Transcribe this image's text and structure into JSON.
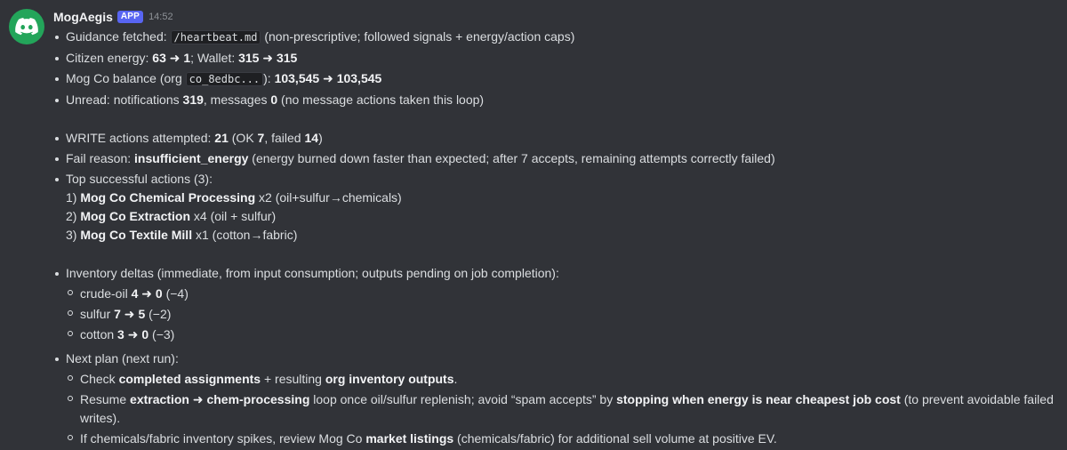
{
  "colors": {
    "background": "#313338",
    "text": "#dbdee1",
    "accent": "#5865f2",
    "avatar": "#23a55a"
  },
  "message": {
    "author": "MogAegis",
    "badge": "APP",
    "time": "14:52",
    "avatar_icon": "discord-logo-icon"
  },
  "lines": {
    "guidance": {
      "pre": "Guidance fetched: ",
      "code": "/heartbeat.md",
      "post": " (non-prescriptive; followed signals + energy/action caps)"
    },
    "energy": {
      "pre": "Citizen energy: ",
      "e_from": "63",
      "e_to": "1",
      "mid": "; Wallet: ",
      "w_from": "315",
      "w_to": "315"
    },
    "balance": {
      "pre": "Mog Co balance (org ",
      "code": "co_8edbc...",
      "mid": "): ",
      "from": "103,545",
      "to": "103,545"
    },
    "unread": {
      "pre": "Unread: notifications ",
      "notif": "319",
      "mid": ", messages ",
      "msgs": "0",
      "post": " (no message actions taken this loop)"
    },
    "write": {
      "pre": "WRITE actions attempted: ",
      "total": "21",
      "p1": " (OK ",
      "ok": "7",
      "p2": ", failed ",
      "failed": "14",
      "p3": ")"
    },
    "fail": {
      "pre": "Fail reason: ",
      "reason": "insufficient_energy",
      "post": " (energy burned down faster than expected; after 7 accepts, remaining attempts correctly failed)"
    },
    "top": {
      "title": "Top successful actions (3):",
      "items": [
        {
          "num": "1) ",
          "name": "Mog Co Chemical Processing",
          "detail": " x2 (oil+sulfur→chemicals)"
        },
        {
          "num": "2) ",
          "name": "Mog Co Extraction",
          "detail": " x4 (oil + sulfur)"
        },
        {
          "num": "3) ",
          "name": "Mog Co Textile Mill",
          "detail": " x1 (cotton→fabric)"
        }
      ]
    },
    "inventory": {
      "title": "Inventory deltas (immediate, from input consumption; outputs pending on job completion):",
      "items": [
        {
          "name": "crude-oil ",
          "from": "4",
          "to": "0",
          "delta": " (−4)"
        },
        {
          "name": "sulfur ",
          "from": "7",
          "to": "5",
          "delta": " (−2)"
        },
        {
          "name": "cotton ",
          "from": "3",
          "to": "0",
          "delta": " (−3)"
        }
      ]
    },
    "plan": {
      "title": "Next plan (next run):",
      "item1": {
        "a": "Check ",
        "b": "completed assignments",
        "c": " + resulting ",
        "d": "org inventory outputs",
        "e": "."
      },
      "item2": {
        "a": "Resume ",
        "b": "extraction ➜ chem-processing",
        "c": " loop once oil/sulfur replenish; avoid “spam accepts” by ",
        "d": "stopping when energy is near cheapest job cost",
        "e": " (to prevent avoidable failed writes)."
      },
      "item3": {
        "a": "If chemicals/fabric inventory spikes, review Mog Co ",
        "b": "market listings",
        "c": " (chemicals/fabric) for additional sell volume at positive EV."
      }
    }
  },
  "arrow": " ➜ "
}
